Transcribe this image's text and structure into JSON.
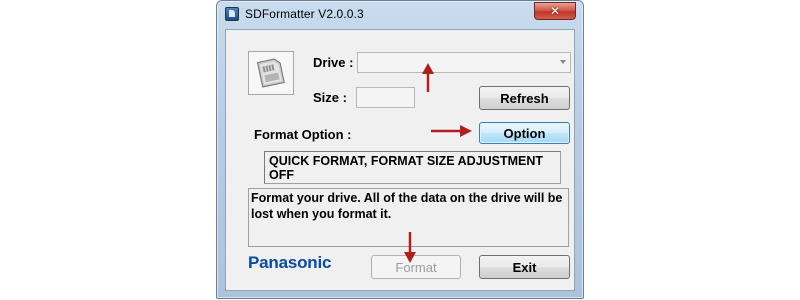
{
  "window": {
    "title": "SDFormatter V2.0.0.3",
    "close_glyph": "✕"
  },
  "drive": {
    "label": "Drive :",
    "value": ""
  },
  "size": {
    "label": "Size  :",
    "value": ""
  },
  "buttons": {
    "refresh": "Refresh",
    "option": "Option",
    "format": "Format",
    "exit": "Exit"
  },
  "format_option": {
    "label": "Format Option :",
    "summary": "QUICK FORMAT, FORMAT SIZE ADJUSTMENT OFF"
  },
  "message": "Format your drive. All of the data on the drive will be lost when you format it.",
  "brand": "Panasonic",
  "icons": {
    "app": "sd-formatter-app-icon",
    "card": "sd-card-icon",
    "dropdown": "chevron-down-icon",
    "close": "close-icon"
  },
  "colors": {
    "annotation_arrow": "#b01e1e",
    "brand": "#0b4ba6"
  }
}
